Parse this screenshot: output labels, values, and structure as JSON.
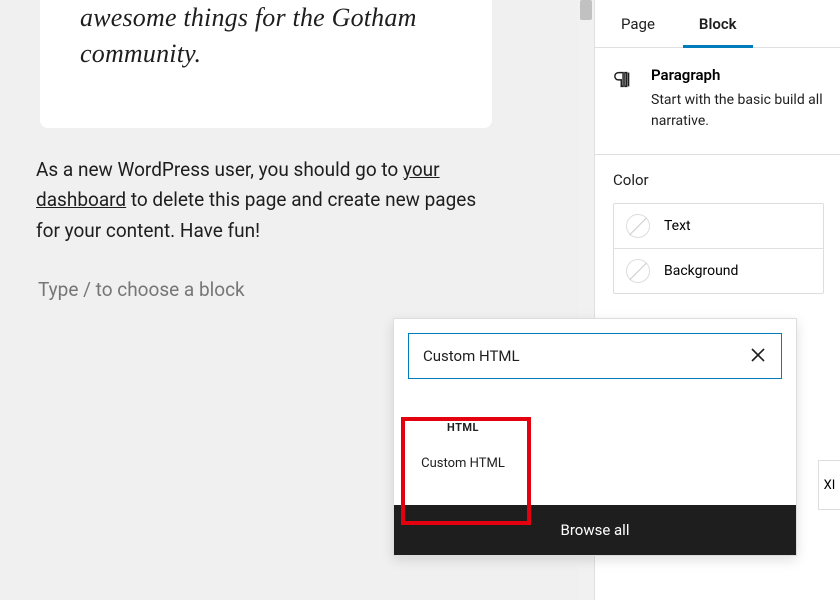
{
  "editor": {
    "quote_text": "awesome things for the Gotham community.",
    "paragraph_prefix": "As a new WordPress user, you should go to ",
    "paragraph_link": "your dashboard",
    "paragraph_suffix": " to delete this page and create new pages for your content. Have fun!",
    "block_placeholder": "Type / to choose a block"
  },
  "sidebar": {
    "tab_page": "Page",
    "tab_block": "Block",
    "block_title": "Paragraph",
    "block_desc": "Start with the basic build all narrative.",
    "color_heading": "Color",
    "color_rows": {
      "text": "Text",
      "background": "Background"
    },
    "typo_hint": "XI"
  },
  "inserter": {
    "search_value": "Custom HTML",
    "result_icon_label": "HTML",
    "result_label": "Custom HTML",
    "browse_all": "Browse all"
  },
  "colors": {
    "accent": "#007cba",
    "highlight": "#e3000f"
  }
}
